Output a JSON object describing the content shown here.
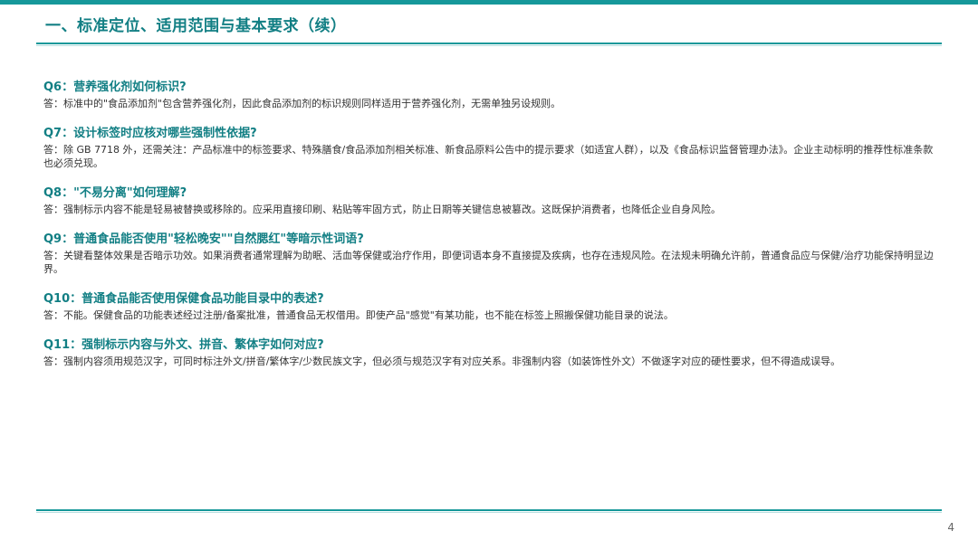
{
  "header": {
    "title": "一、标准定位、适用范围与基本要求（续）"
  },
  "qa": [
    {
      "question": "Q6：营养强化剂如何标识?",
      "answer": "答：标准中的\"食品添加剂\"包含营养强化剂，因此食品添加剂的标识规则同样适用于营养强化剂，无需单独另设规则。"
    },
    {
      "question": "Q7：设计标签时应核对哪些强制性依据?",
      "answer": "答：除 GB 7718 外，还需关注：产品标准中的标签要求、特殊膳食/食品添加剂相关标准、新食品原料公告中的提示要求（如适宜人群），以及《食品标识监督管理办法》。企业主动标明的推荐性标准条款也必须兑现。"
    },
    {
      "question": "Q8：\"不易分离\"如何理解?",
      "answer": "答：强制标示内容不能是轻易被替换或移除的。应采用直接印刷、粘贴等牢固方式，防止日期等关键信息被篡改。这既保护消费者，也降低企业自身风险。"
    },
    {
      "question": "Q9：普通食品能否使用\"轻松晚安\"\"自然腮红\"等暗示性词语?",
      "answer": "答：关键看整体效果是否暗示功效。如果消费者通常理解为助眠、活血等保健或治疗作用，即便词语本身不直接提及疾病，也存在违规风险。在法规未明确允许前，普通食品应与保健/治疗功能保持明显边界。"
    },
    {
      "question": "Q10：普通食品能否使用保健食品功能目录中的表述?",
      "answer": "答：不能。保健食品的功能表述经过注册/备案批准，普通食品无权借用。即使产品\"感觉\"有某功能，也不能在标签上照搬保健功能目录的说法。"
    },
    {
      "question": "Q11：强制标示内容与外文、拼音、繁体字如何对应?",
      "answer": "答：强制内容须用规范汉字，可同时标注外文/拼音/繁体字/少数民族文字，但必须与规范汉字有对应关系。非强制内容（如装饰性外文）不做逐字对应的硬性要求，但不得造成误导。"
    }
  ],
  "footer": {
    "page_number": "4"
  },
  "colors": {
    "accent": "#16989a",
    "question_text": "#127f84",
    "body_text": "#333333"
  }
}
